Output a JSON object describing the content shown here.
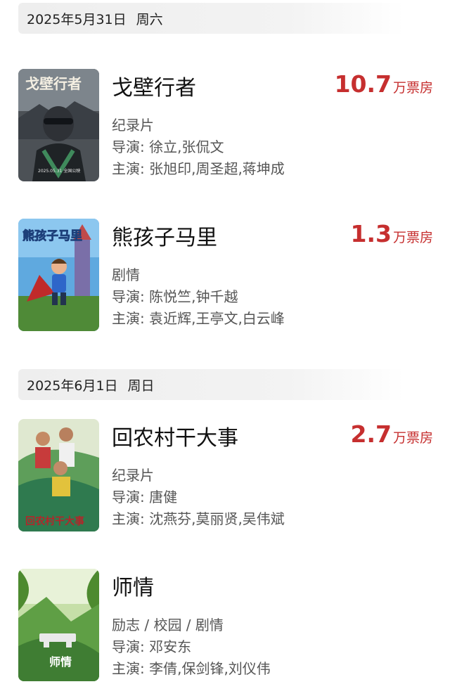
{
  "dates": [
    {
      "date": "2025年5月31日",
      "weekday": "周六",
      "movies": [
        {
          "title": "戈壁行者",
          "box_value": "10.7",
          "box_unit": "万票房",
          "genre": "纪录片",
          "director": "导演: 徐立,张侃文",
          "cast": "主演: 张旭印,周圣超,蒋坤成",
          "poster_text": "戈壁行者",
          "poster_caption": "2025.05.31 全国公映"
        },
        {
          "title": "熊孩子马里",
          "box_value": "1.3",
          "box_unit": "万票房",
          "genre": "剧情",
          "director": "导演: 陈悦竺,钟千越",
          "cast": "主演: 袁近辉,王亭文,白云峰",
          "poster_text": "熊孩子马里"
        }
      ]
    },
    {
      "date": "2025年6月1日",
      "weekday": "周日",
      "movies": [
        {
          "title": "回农村干大事",
          "box_value": "2.7",
          "box_unit": "万票房",
          "genre": "纪录片",
          "director": "导演: 唐健",
          "cast": "主演: 沈燕芬,莫丽贤,吴伟斌",
          "poster_text": "回农村干大事"
        },
        {
          "title": "师情",
          "box_value": "",
          "box_unit": "",
          "genre": "励志 / 校园 / 剧情",
          "director": "导演: 邓安东",
          "cast": "主演: 李倩,保剑锋,刘仪伟",
          "poster_text": "师情"
        }
      ]
    }
  ],
  "colors": {
    "box_office_red": "#c62f2f",
    "date_header_bg": "#eeeeee",
    "title": "#111111",
    "info": "#555555"
  }
}
